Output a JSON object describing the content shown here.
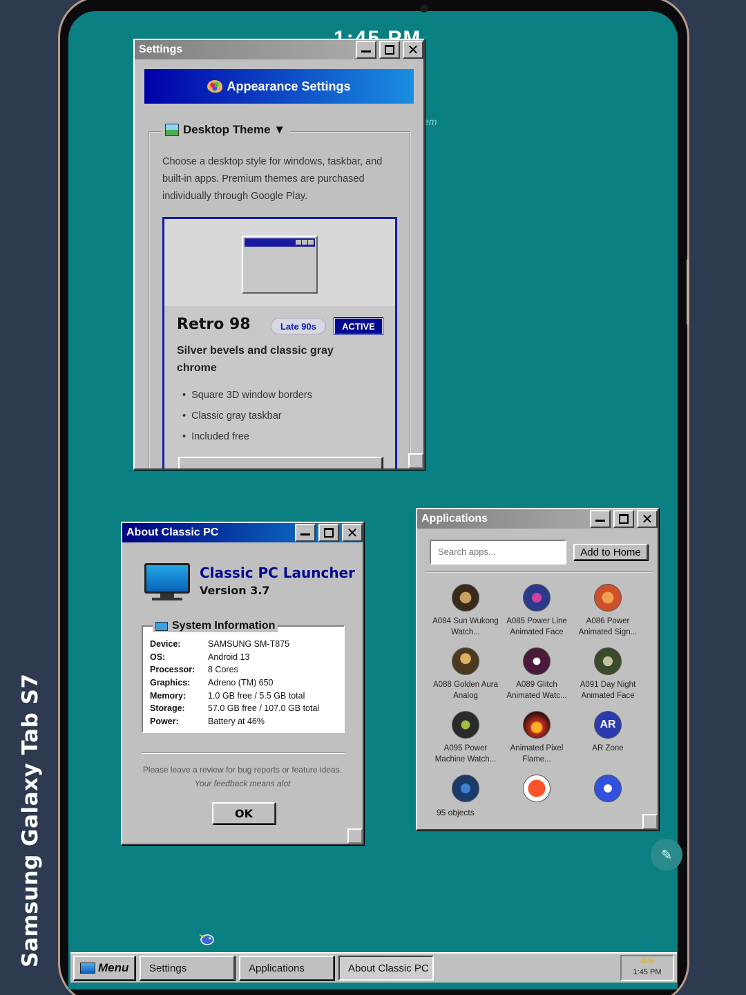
{
  "device": {
    "brand_label": "Samsung Galaxy Tab S7"
  },
  "status": {
    "clock_big": "1:45 PM",
    "ghost_text": "em"
  },
  "settings": {
    "title": "Settings",
    "banner": "Appearance Settings",
    "group_label": "Desktop Theme ▼",
    "description": "Choose a desktop style for windows, taskbar, and built-in apps. Premium themes are purchased individually through Google Play.",
    "theme": {
      "name": "Retro 98",
      "era": "Late 90s",
      "status": "ACTIVE",
      "subtitle": "Silver bevels and classic gray chrome",
      "features": [
        "Square 3D window borders",
        "Classic gray taskbar",
        "Included free"
      ]
    }
  },
  "about": {
    "title": "About Classic PC",
    "app_name": "Classic PC Launcher",
    "version": "Version 3.7",
    "section_title": "System Information",
    "rows": [
      {
        "k": "Device:",
        "v": "SAMSUNG SM-T875"
      },
      {
        "k": "OS:",
        "v": "Android 13"
      },
      {
        "k": "Processor:",
        "v": "8 Cores"
      },
      {
        "k": "Graphics:",
        "v": "Adreno (TM) 650"
      },
      {
        "k": "Memory:",
        "v": "1.0 GB free / 5.5 GB total"
      },
      {
        "k": "Storage:",
        "v": "57.0 GB free / 107.0 GB total"
      },
      {
        "k": "Power:",
        "v": "Battery at 46%"
      }
    ],
    "note": "Please leave a review for bug reports or feature ideas.",
    "note2": "Your feedback means alot",
    "ok": "OK"
  },
  "apps": {
    "title": "Applications",
    "search_placeholder": "Search apps...",
    "add_home": "Add to Home",
    "items": [
      {
        "label": "A084 Sun Wukong Watch...",
        "color": "#3a2a1a"
      },
      {
        "label": "A085 Power Line Animated Face",
        "color": "#2a3a8a"
      },
      {
        "label": "A086 Power Animated Sign...",
        "color": "#d0502a"
      },
      {
        "label": "A088 Golden Aura Analog",
        "color": "#4a3a20"
      },
      {
        "label": "A089 Glitch Animated Watc...",
        "color": "#4a1a3a"
      },
      {
        "label": "A091 Day Night Animated Face",
        "color": "#3a4a2a"
      },
      {
        "label": "A095 Power Machine Watch...",
        "color": "#2a2a2a"
      },
      {
        "label": "Animated Pixel Flame...",
        "color": "#c03020"
      },
      {
        "label": "AR Zone",
        "color": "#2a3ab0"
      },
      {
        "label": "",
        "color": "#1a3a6a"
      },
      {
        "label": "",
        "color": "#ffffff"
      },
      {
        "label": "",
        "color": "#3050e0"
      }
    ],
    "ar_text": "AR",
    "objects": "95 objects"
  },
  "taskbar": {
    "menu": "Menu",
    "items": [
      "Settings",
      "Applications",
      "About Classic PC"
    ],
    "battery": "46%",
    "time": "1:45 PM"
  },
  "colors": {
    "desktop": "#0a8082",
    "title_active": "#000080",
    "face": "#c0c0c0"
  }
}
